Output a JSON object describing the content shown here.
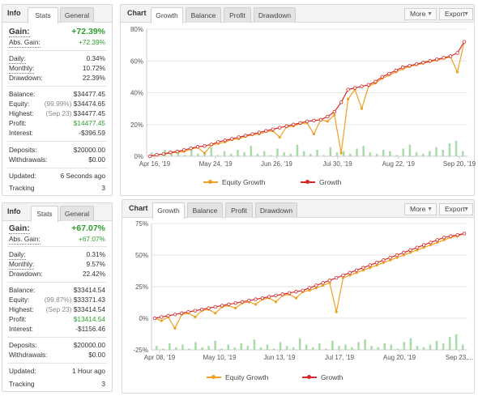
{
  "top": {
    "info": {
      "title": "Info",
      "tabs": [
        "Stats",
        "General"
      ],
      "gain": {
        "label": "Gain:",
        "value": "+72.39%"
      },
      "abs_gain": {
        "label": "Abs. Gain:",
        "value": "+72.39%"
      },
      "daily": {
        "label": "Daily:",
        "value": "0.34%"
      },
      "monthly": {
        "label": "Monthly:",
        "value": "10.72%"
      },
      "drawdown": {
        "label": "Drawdown:",
        "value": "22.39%"
      },
      "balance": {
        "label": "Balance:",
        "value": "$34477.45"
      },
      "equity": {
        "label": "Equity:",
        "note": "(99.99%)",
        "value": "$34474.65"
      },
      "highest": {
        "label": "Highest:",
        "note": "(Sep 23)",
        "value": "$34477.45"
      },
      "profit": {
        "label": "Profit:",
        "value": "$14477.45"
      },
      "interest": {
        "label": "Interest:",
        "value": "-$396.59"
      },
      "deposits": {
        "label": "Deposits:",
        "value": "$20000.00"
      },
      "withdrawals": {
        "label": "Withdrawals:",
        "value": "$0.00"
      },
      "updated": {
        "label": "Updated:",
        "value": "6 Seconds ago"
      },
      "tracking": {
        "label": "Tracking",
        "value": "3"
      }
    },
    "chart": {
      "title": "Chart",
      "tabs": [
        "Growth",
        "Balance",
        "Profit",
        "Drawdown"
      ],
      "more": "More",
      "export": "Export",
      "legend": [
        "Equity Growth",
        "Growth"
      ]
    }
  },
  "bottom": {
    "info": {
      "title": "Info",
      "tabs": [
        "Stats",
        "General"
      ],
      "gain": {
        "label": "Gain:",
        "value": "+67.07%"
      },
      "abs_gain": {
        "label": "Abs. Gain:",
        "value": "+67.07%"
      },
      "daily": {
        "label": "Daily:",
        "value": "0.31%"
      },
      "monthly": {
        "label": "Monthly:",
        "value": "9.57%"
      },
      "drawdown": {
        "label": "Drawdown:",
        "value": "22.42%"
      },
      "balance": {
        "label": "Balance:",
        "value": "$33414.54"
      },
      "equity": {
        "label": "Equity:",
        "note": "(99.87%)",
        "value": "$33371.43"
      },
      "highest": {
        "label": "Highest:",
        "note": "(Sep 23)",
        "value": "$33414.54"
      },
      "profit": {
        "label": "Profit:",
        "value": "$13414.54"
      },
      "interest": {
        "label": "Interest:",
        "value": "-$1156.46"
      },
      "deposits": {
        "label": "Deposits:",
        "value": "$20000.00"
      },
      "withdrawals": {
        "label": "Withdrawals:",
        "value": "$0.00"
      },
      "updated": {
        "label": "Updated:",
        "value": "1 Hour ago"
      },
      "tracking": {
        "label": "Tracking",
        "value": "3"
      }
    },
    "chart": {
      "title": "Chart",
      "tabs": [
        "Growth",
        "Balance",
        "Profit",
        "Drawdown"
      ],
      "more": "More",
      "export": "Export",
      "legend": [
        "Equity Growth",
        "Growth"
      ]
    }
  },
  "colors": {
    "growth": "#d62728",
    "equity": "#f0a020",
    "bars": "#a8dba8",
    "positive": "#2ea02e"
  },
  "chart_data": [
    {
      "type": "line",
      "x_labels": [
        "Apr 16, '19",
        "May 24, '19",
        "Jun 26, '19",
        "Jul 30, '19",
        "Aug 22, '19",
        "Sep 20, '19"
      ],
      "y_ticks": [
        "0%",
        "20%",
        "40%",
        "60%",
        "80%"
      ],
      "ylim": [
        0,
        80
      ],
      "grid": true,
      "legend_position": "bottom",
      "series": [
        {
          "name": "Growth",
          "values": [
            0,
            1,
            1.5,
            2.5,
            3,
            4,
            5,
            6,
            6.5,
            7.5,
            9,
            10,
            11,
            12,
            13,
            14,
            15,
            16,
            17,
            18,
            19,
            20,
            21,
            22,
            22.5,
            23,
            25,
            28,
            34,
            42,
            43,
            44,
            45,
            47,
            50,
            52,
            54,
            56,
            57,
            58,
            59,
            60,
            61,
            62,
            63,
            65,
            72
          ]
        },
        {
          "name": "Equity Growth",
          "values": [
            0,
            1,
            1.2,
            2,
            2.5,
            3,
            4.5,
            5.5,
            2,
            7,
            8,
            9,
            10.5,
            11,
            12.5,
            13.5,
            14,
            15.5,
            16,
            12,
            18.5,
            19,
            20.5,
            21,
            14,
            23,
            22,
            26,
            2,
            36,
            42,
            30,
            44,
            46,
            49,
            51,
            53,
            55,
            56.5,
            57.5,
            58.5,
            59.5,
            60.5,
            61.5,
            62.5,
            53,
            72
          ]
        }
      ]
    },
    {
      "type": "line",
      "x_labels": [
        "Apr 08, '19",
        "May 10, '19",
        "Jun 13, '19",
        "Jul 17, '19",
        "Aug 20, '19",
        "Sep 23,..."
      ],
      "y_ticks": [
        "-25%",
        "0%",
        "25%",
        "50%",
        "75%"
      ],
      "ylim": [
        -25,
        75
      ],
      "grid": true,
      "legend_position": "bottom",
      "series": [
        {
          "name": "Growth",
          "values": [
            0,
            1,
            2,
            3,
            4,
            5,
            6,
            7,
            8,
            9,
            10,
            11,
            12,
            13,
            14,
            15,
            16,
            17,
            18,
            19,
            20,
            21,
            22,
            24,
            26,
            28,
            30,
            32,
            34,
            36,
            38,
            40,
            42,
            44,
            46,
            48,
            50,
            52,
            54,
            56,
            58,
            60,
            62,
            64,
            65,
            66,
            67
          ]
        },
        {
          "name": "Equity Growth",
          "values": [
            0,
            -2,
            1,
            -8,
            3,
            4,
            1,
            6,
            7,
            4,
            9,
            10,
            8,
            12,
            13,
            11,
            15,
            16,
            13,
            18,
            19,
            16,
            21,
            22,
            24,
            26,
            28,
            5,
            32,
            34,
            36,
            38,
            40,
            42,
            44,
            46,
            48,
            50,
            52,
            54,
            56,
            58,
            60,
            62,
            64,
            65,
            67
          ]
        }
      ]
    }
  ]
}
